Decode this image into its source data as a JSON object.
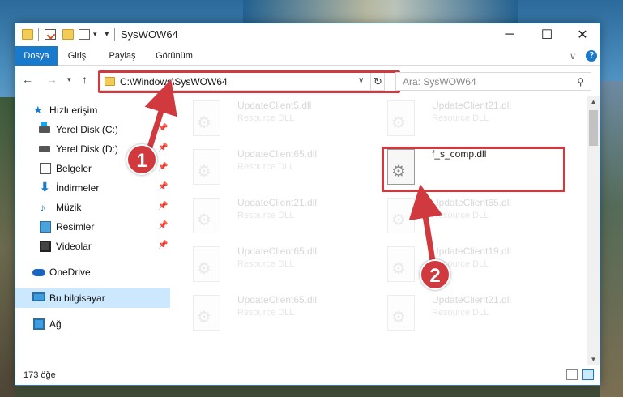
{
  "window": {
    "title": "SysWOW64"
  },
  "ribbon": {
    "tabs": [
      "Dosya",
      "Giriş",
      "Paylaş",
      "Görünüm"
    ]
  },
  "address": {
    "path": "C:\\Windows\\SysWOW64"
  },
  "search": {
    "placeholder": "Ara: SysWOW64"
  },
  "sidebar": {
    "items": [
      {
        "label": "Hızlı erişim",
        "icon": "star-icon",
        "pinned": false
      },
      {
        "label": "Yerel Disk (C:)",
        "icon": "drive-c-icon",
        "pinned": true
      },
      {
        "label": "Yerel Disk (D:)",
        "icon": "drive-d-icon",
        "pinned": true
      },
      {
        "label": "Belgeler",
        "icon": "documents-icon",
        "pinned": true
      },
      {
        "label": "İndirmeler",
        "icon": "downloads-icon",
        "pinned": true
      },
      {
        "label": "Müzik",
        "icon": "music-icon",
        "pinned": true
      },
      {
        "label": "Resimler",
        "icon": "pictures-icon",
        "pinned": true
      },
      {
        "label": "Videolar",
        "icon": "videos-icon",
        "pinned": true
      },
      {
        "label": "OneDrive",
        "icon": "onedrive-icon",
        "pinned": false
      },
      {
        "label": "Bu bilgisayar",
        "icon": "this-pc-icon",
        "pinned": false,
        "selected": true
      },
      {
        "label": "Ağ",
        "icon": "network-icon",
        "pinned": false
      }
    ]
  },
  "files": {
    "left": [
      {
        "name": "UpdateClient5.dll",
        "desc": "Resource DLL"
      },
      {
        "name": "UpdateClient65.dll",
        "desc": "Resource DLL"
      },
      {
        "name": "UpdateClient21.dll",
        "desc": "Resource DLL"
      },
      {
        "name": "UpdateClient65.dll",
        "desc": "Resource DLL"
      },
      {
        "name": "UpdateClient65.dll",
        "desc": "Resource DLL"
      }
    ],
    "right": [
      {
        "name": "UpdateClient21.dll",
        "desc": "Resource DLL"
      },
      {
        "name": "f_s_comp.dll",
        "desc": ""
      },
      {
        "name": "UpdateClient65.dll",
        "desc": "Resource DLL"
      },
      {
        "name": "UpdateClient19.dll",
        "desc": "Resource DLL"
      },
      {
        "name": "UpdateClient21.dll",
        "desc": "Resource DLL"
      }
    ]
  },
  "status": {
    "item_count": "173 öğe"
  },
  "annotations": {
    "step1": "1",
    "step2": "2",
    "color": "#d0393e"
  }
}
